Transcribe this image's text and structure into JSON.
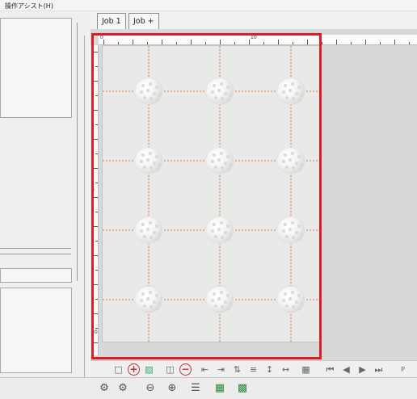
{
  "menu": {
    "assist_label": "操作アシスト(H)"
  },
  "tabs": [
    {
      "label": "Job 1"
    },
    {
      "label": "Job +"
    }
  ],
  "layout": {
    "rows": 4,
    "columns": 3,
    "item": "golf-ball",
    "guide_color": "#e8743a"
  },
  "colors": {
    "selection": "#e01b24",
    "page": "#e9e9e7",
    "canvas_bg": "#d8d8d8"
  },
  "ruler": {
    "top_labels": [
      "0",
      "10"
    ],
    "left_labels": [
      "0",
      "20"
    ]
  },
  "toolbar": {
    "icons": [
      "page-icon",
      "zoom-in-icon",
      "print-icon",
      "image-icon",
      "zoom-out-icon",
      "align-left-icon",
      "align-right-icon",
      "distribute-icon",
      "text-align-icon",
      "center-h-icon",
      "center-v-icon",
      "layout-icon",
      "first-icon",
      "prev-icon",
      "next-icon",
      "last-icon",
      "page-number-icon"
    ]
  },
  "statusbar": {
    "icons": [
      "object-add-icon",
      "object-remove-icon",
      "zoom-out-icon",
      "zoom-in-icon",
      "list-icon",
      "grid-icon",
      "grid-fill-icon"
    ]
  }
}
